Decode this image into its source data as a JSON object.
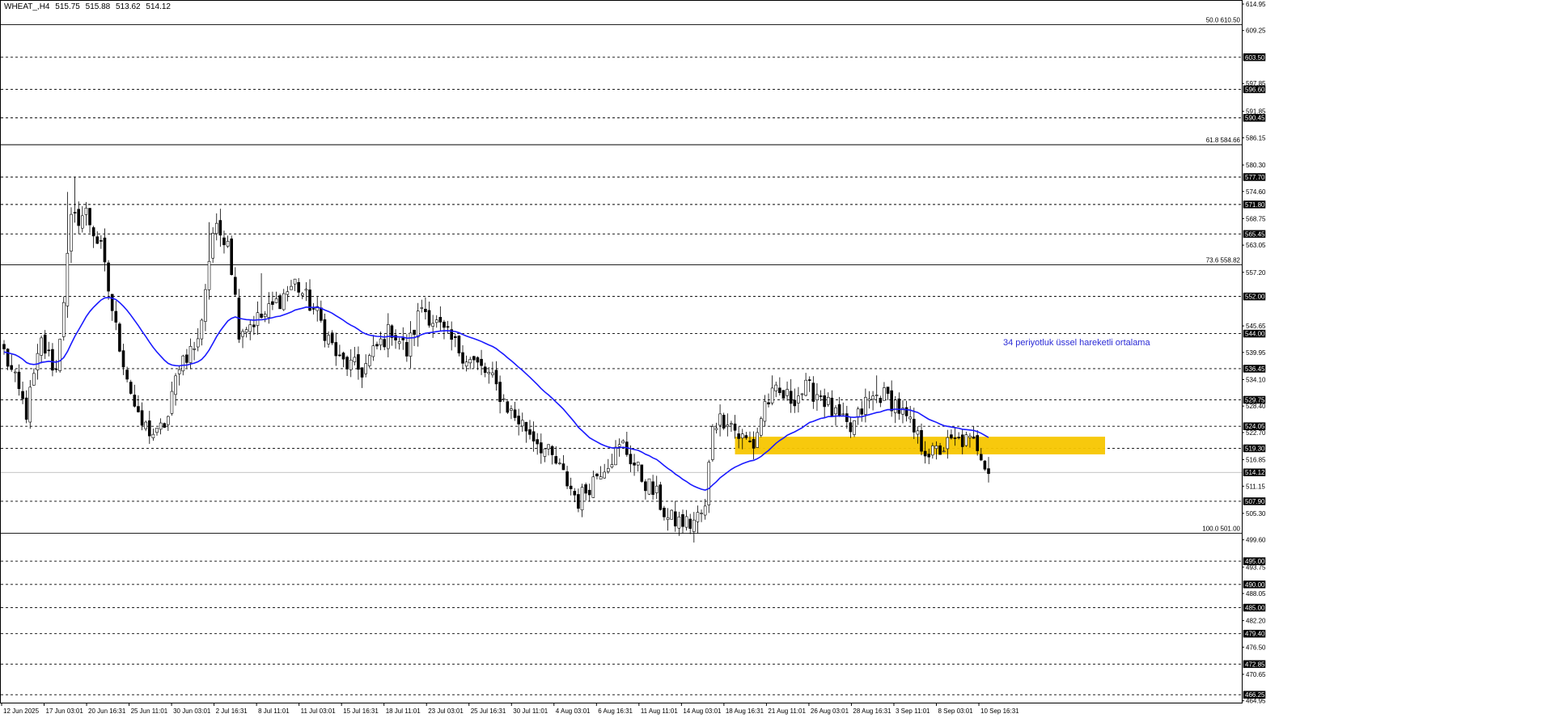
{
  "header": {
    "symbol": "WHEAT_,H4",
    "open": "515.75",
    "high": "515.88",
    "low": "513.62",
    "close": "514.12"
  },
  "chart_data": {
    "type": "candlestick",
    "instrument": "WHEAT_",
    "timeframe": "H4",
    "ylim": [
      464.55,
      614.95
    ],
    "grid": false,
    "y_ticks": [
      614.95,
      609.25,
      597.85,
      591.85,
      586.15,
      580.3,
      574.6,
      568.75,
      563.05,
      557.2,
      545.65,
      539.95,
      534.1,
      528.4,
      522.7,
      516.85,
      511.15,
      505.3,
      499.6,
      493.75,
      488.05,
      482.2,
      476.5,
      470.65,
      464.95
    ],
    "x_ticks": [
      "12 Jun 2025",
      "17 Jun 03:01",
      "20 Jun 16:31",
      "25 Jun 11:01",
      "30 Jun 03:01",
      "2 Jul 16:31",
      "8 Jul 11:01",
      "11 Jul 03:01",
      "15 Jul 16:31",
      "18 Jul 11:01",
      "23 Jul 03:01",
      "25 Jul 16:31",
      "30 Jul 11:01",
      "4 Aug 03:01",
      "6 Aug 16:31",
      "11 Aug 11:01",
      "14 Aug 03:01",
      "18 Aug 16:31",
      "21 Aug 11:01",
      "26 Aug 03:01",
      "28 Aug 16:31",
      "3 Sep 11:01",
      "8 Sep 03:01",
      "10 Sep 16:31"
    ],
    "horizontal_levels": [
      {
        "price": 603.5,
        "label": "603.50"
      },
      {
        "price": 596.6,
        "label": "596.60"
      },
      {
        "price": 590.45,
        "label": "590.45"
      },
      {
        "price": 577.7,
        "label": "577.70"
      },
      {
        "price": 571.8,
        "label": "571.80"
      },
      {
        "price": 565.45,
        "label": "565.45"
      },
      {
        "price": 552.0,
        "label": "552.00"
      },
      {
        "price": 544.0,
        "label": "544.00"
      },
      {
        "price": 536.45,
        "label": "536.45"
      },
      {
        "price": 529.75,
        "label": "529.75"
      },
      {
        "price": 524.05,
        "label": "524.05"
      },
      {
        "price": 519.3,
        "label": "519.30"
      },
      {
        "price": 507.9,
        "label": "507.90"
      },
      {
        "price": 495.0,
        "label": "495.00"
      },
      {
        "price": 490.0,
        "label": "490.00"
      },
      {
        "price": 485.0,
        "label": "485.00"
      },
      {
        "price": 479.4,
        "label": "479.40"
      },
      {
        "price": 472.85,
        "label": "472.85"
      },
      {
        "price": 466.25,
        "label": "466.25"
      }
    ],
    "fibonacci_levels": [
      {
        "price": 610.5,
        "label": "50.0 610.50"
      },
      {
        "price": 584.66,
        "label": "61.8 584.66"
      },
      {
        "price": 558.82,
        "label": "73.6 558.82"
      },
      {
        "price": 501.0,
        "label": "100.0 501.00"
      }
    ],
    "current_price": {
      "price": 514.12,
      "label": "514.12"
    },
    "zone": {
      "from": 518.0,
      "to": 521.8,
      "start_index": 196,
      "end_index": 300,
      "color": "#f7c600"
    },
    "annotation": {
      "text": "34 periyotluk üssel hareketli ortalama",
      "color": "#2b2bd6"
    },
    "moving_average": {
      "name": "34 periyotluk üssel hareketli ortalama",
      "period": 34,
      "type": "EMA",
      "color": "#1a1aff"
    },
    "anchor_closes": [
      [
        0,
        540.0
      ],
      [
        6,
        527.0
      ],
      [
        10,
        542.0
      ],
      [
        14,
        536.0
      ],
      [
        18,
        568.0
      ],
      [
        22,
        570.0
      ],
      [
        26,
        562.0
      ],
      [
        30,
        545.0
      ],
      [
        36,
        525.0
      ],
      [
        41,
        522.0
      ],
      [
        44,
        526.0
      ],
      [
        47,
        538.0
      ],
      [
        52,
        542.0
      ],
      [
        56,
        566.0
      ],
      [
        60,
        565.0
      ],
      [
        63,
        545.0
      ],
      [
        70,
        548.0
      ],
      [
        78,
        555.0
      ],
      [
        84,
        548.0
      ],
      [
        90,
        538.0
      ],
      [
        96,
        536.0
      ],
      [
        100,
        541.0
      ],
      [
        104,
        545.0
      ],
      [
        108,
        540.0
      ],
      [
        112,
        550.0
      ],
      [
        118,
        544.0
      ],
      [
        124,
        539.0
      ],
      [
        130,
        535.0
      ],
      [
        136,
        527.0
      ],
      [
        142,
        522.0
      ],
      [
        148,
        516.0
      ],
      [
        154,
        508.0
      ],
      [
        160,
        515.0
      ],
      [
        166,
        520.0
      ],
      [
        171,
        513.0
      ],
      [
        175,
        509.0
      ],
      [
        178,
        504.0
      ],
      [
        184,
        503.0
      ],
      [
        188,
        506.0
      ],
      [
        190,
        525.0
      ],
      [
        194,
        526.0
      ],
      [
        197,
        522.0
      ],
      [
        201,
        520.0
      ],
      [
        204,
        529.0
      ],
      [
        207,
        531.0
      ],
      [
        211,
        530.0
      ],
      [
        215,
        532.0
      ],
      [
        219,
        531.0
      ],
      [
        223,
        526.0
      ],
      [
        227,
        523.0
      ],
      [
        231,
        529.0
      ],
      [
        235,
        531.0
      ],
      [
        239,
        529.0
      ],
      [
        243,
        524.0
      ],
      [
        246,
        520.0
      ],
      [
        249,
        518.0
      ],
      [
        253,
        520.0
      ],
      [
        257,
        521.0
      ],
      [
        261,
        520.0
      ],
      [
        264,
        515.0
      ]
    ],
    "candle_count": 265,
    "style": {
      "bull_color": "#ffffff",
      "bear_color": "#000000",
      "outline": "#000000"
    }
  }
}
